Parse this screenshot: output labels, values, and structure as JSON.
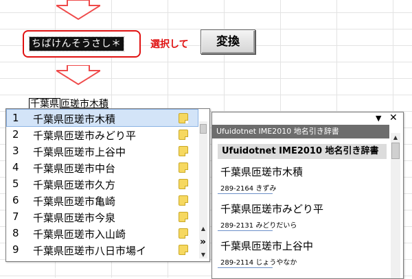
{
  "reading": {
    "text": "ちばけんそうさし＊"
  },
  "instruction": {
    "text": "選択して"
  },
  "convert_key": {
    "label": "変換"
  },
  "converted_text": {
    "selected": "千葉県",
    "rest": "匝瑳市木積"
  },
  "candidate_list": {
    "items": [
      {
        "num": "1",
        "text": "千葉県匝瑳市木積"
      },
      {
        "num": "2",
        "text": "千葉県匝瑳市みどり平"
      },
      {
        "num": "3",
        "text": "千葉県匝瑳市上谷中"
      },
      {
        "num": "4",
        "text": "千葉県匝瑳市中台"
      },
      {
        "num": "5",
        "text": "千葉県匝瑳市久方"
      },
      {
        "num": "6",
        "text": "千葉県匝瑳市亀崎"
      },
      {
        "num": "7",
        "text": "千葉県匝瑳市今泉"
      },
      {
        "num": "8",
        "text": "千葉県匝瑳市入山崎"
      },
      {
        "num": "9",
        "text": "千葉県匝瑳市八日市場イ"
      }
    ],
    "selected_index": 0,
    "expand_label": "»"
  },
  "dictionary_panel": {
    "header": "Ufuidotnet IME2010 地名引き辞書",
    "title": "Ufuidotnet IME2010 地名引き辞書",
    "menu_glyph": "▼",
    "close_glyph": "✕",
    "entries": [
      {
        "name": "千葉県匝瑳市木積",
        "detail": "289-2164 きずみ"
      },
      {
        "name": "千葉県匝瑳市みどり平",
        "detail": "289-2131 みどりだいら"
      },
      {
        "name": "千葉県匝瑳市上谷中",
        "detail": "289-2114 じょうやなか"
      }
    ]
  },
  "colors": {
    "accent_red": "#e01010",
    "selection_blue": "#d3e4f8"
  },
  "icons": [
    "down-arrow-icon",
    "dictionary-note-icon",
    "scroll-up-icon",
    "scroll-down-icon",
    "dropdown-arrow-icon",
    "close-icon"
  ]
}
